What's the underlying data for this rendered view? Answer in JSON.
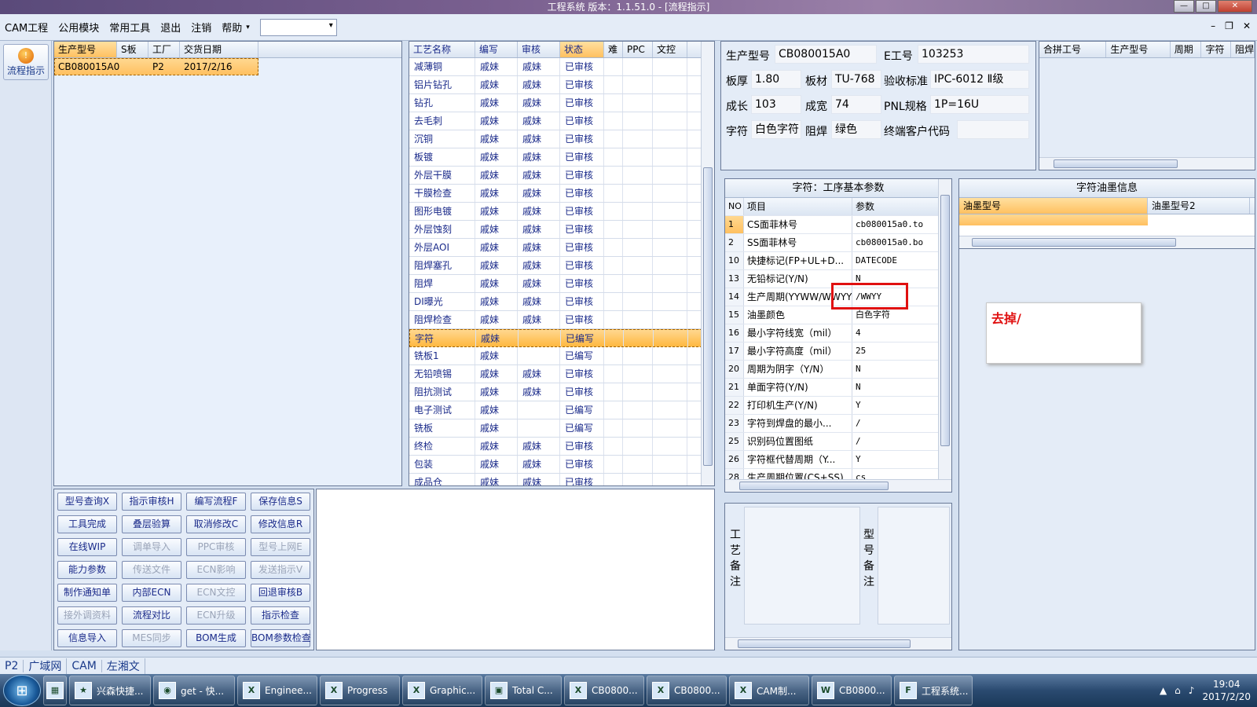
{
  "title": "工程系统  版本：1.1.51.0 - [流程指示]",
  "menu": [
    "CAM工程",
    "公用模块",
    "常用工具",
    "退出",
    "注销",
    "帮助"
  ],
  "flow_button": "流程指示",
  "orders": {
    "headers": [
      "生产型号",
      "S板",
      "工厂",
      "交货日期"
    ],
    "rows": [
      [
        "CB080015A0",
        "",
        "P2",
        "2017/2/16"
      ]
    ]
  },
  "process": {
    "headers": [
      "工艺名称",
      "编写",
      "审核",
      "状态",
      "难",
      "PPC",
      "文控"
    ],
    "rows": [
      [
        "减薄铜",
        "戚妹",
        "戚妹",
        "已审核"
      ],
      [
        "铝片钻孔",
        "戚妹",
        "戚妹",
        "已审核"
      ],
      [
        "钻孔",
        "戚妹",
        "戚妹",
        "已审核"
      ],
      [
        "去毛刺",
        "戚妹",
        "戚妹",
        "已审核"
      ],
      [
        "沉铜",
        "戚妹",
        "戚妹",
        "已审核"
      ],
      [
        "板镀",
        "戚妹",
        "戚妹",
        "已审核"
      ],
      [
        "外层干膜",
        "戚妹",
        "戚妹",
        "已审核"
      ],
      [
        "干膜检查",
        "戚妹",
        "戚妹",
        "已审核"
      ],
      [
        "图形电镀",
        "戚妹",
        "戚妹",
        "已审核"
      ],
      [
        "外层蚀刻",
        "戚妹",
        "戚妹",
        "已审核"
      ],
      [
        "外层AOI",
        "戚妹",
        "戚妹",
        "已审核"
      ],
      [
        "阻焊塞孔",
        "戚妹",
        "戚妹",
        "已审核"
      ],
      [
        "阻焊",
        "戚妹",
        "戚妹",
        "已审核"
      ],
      [
        "DI曝光",
        "戚妹",
        "戚妹",
        "已审核"
      ],
      [
        "阻焊检查",
        "戚妹",
        "戚妹",
        "已审核"
      ],
      [
        "字符",
        "戚妹",
        "",
        "已编写"
      ],
      [
        "铣板1",
        "戚妹",
        "",
        "已编写"
      ],
      [
        "无铅喷锡",
        "戚妹",
        "戚妹",
        "已审核"
      ],
      [
        "阻抗测试",
        "戚妹",
        "戚妹",
        "已审核"
      ],
      [
        "电子测试",
        "戚妹",
        "",
        "已编写"
      ],
      [
        "铣板",
        "戚妹",
        "",
        "已编写"
      ],
      [
        "终检",
        "戚妹",
        "戚妹",
        "已审核"
      ],
      [
        "包装",
        "戚妹",
        "戚妹",
        "已审核"
      ],
      [
        "成品仓",
        "戚妹",
        "戚妹",
        "已审核"
      ]
    ]
  },
  "buttons": [
    [
      "型号查询X",
      "指示审核H",
      "编写流程F",
      "保存信息S"
    ],
    [
      "工具完成",
      "叠层验算",
      "取消修改C",
      "修改信息R"
    ],
    [
      "在线WIP",
      "调单导入",
      "PPC审核",
      "型号上网E"
    ],
    [
      "能力参数",
      "传送文件",
      "ECN影响",
      "发送指示V"
    ],
    [
      "制作通知单",
      "内部ECN",
      "ECN文控",
      "回退审核B"
    ],
    [
      "接外调资料",
      "流程对比",
      "ECN升级",
      "指示检查"
    ],
    [
      "信息导入",
      "MES同步",
      "BOM生成",
      "BOM参数检查"
    ]
  ],
  "disabled_buttons": [
    "调单导入",
    "PPC审核",
    "型号上网E",
    "传送文件",
    "ECN影响",
    "发送指示V",
    "ECN文控",
    "接外调资料",
    "ECN升级",
    "MES同步"
  ],
  "info": {
    "l_model": "生产型号",
    "model": "CB080015A0",
    "l_e": "E工号",
    "e": "103253",
    "l_thick": "板厚",
    "thick": "1.80",
    "l_mat": "板材",
    "mat": "TU-768",
    "l_acc": "验收标准",
    "acc": "IPC-6012 Ⅱ级",
    "l_len": "成长",
    "len": "103",
    "l_wid": "成宽",
    "wid": "74",
    "l_pnl": "PNL规格",
    "pnl": "1P=16U",
    "l_char": "字符",
    "char": "白色字符",
    "l_mask": "阻焊",
    "mask": "绿色",
    "l_cust": "终端客户代码",
    "cust": ""
  },
  "merge_headers": [
    "合拼工号",
    "生产型号",
    "周期",
    "字符",
    "阻焊"
  ],
  "params": {
    "title": "字符：工序基本参数",
    "headers": [
      "NO",
      "项目",
      "参数"
    ],
    "rows": [
      [
        "1",
        "CS面菲林号",
        "cb080015a0.to"
      ],
      [
        "2",
        "SS面菲林号",
        "cb080015a0.bo"
      ],
      [
        "10",
        "快捷标记(FP+UL+D...",
        "DATECODE"
      ],
      [
        "13",
        "无铅标记(Y/N)",
        "N"
      ],
      [
        "14",
        "生产周期(YYWW/WWYY)",
        "/WWYY"
      ],
      [
        "15",
        "油墨颜色",
        "白色字符"
      ],
      [
        "16",
        "最小字符线宽（mil）",
        "4"
      ],
      [
        "17",
        "最小字符高度（mil）",
        "25"
      ],
      [
        "20",
        "周期为阴字（Y/N）",
        "N"
      ],
      [
        "21",
        "单面字符(Y/N)",
        "N"
      ],
      [
        "22",
        "打印机生产(Y/N)",
        "Y"
      ],
      [
        "23",
        "字符到焊盘的最小...",
        "/"
      ],
      [
        "25",
        "识别码位置图纸",
        "/"
      ],
      [
        "26",
        "字符框代替周期（Y...",
        "Y"
      ],
      [
        "28",
        "生产周期位置(CS+SS)",
        "cs"
      ]
    ]
  },
  "notes": {
    "process_label": "工艺备注",
    "model_label": "型号备注"
  },
  "ink": {
    "title": "字符油墨信息",
    "headers": [
      "油墨型号",
      "油墨型号2"
    ]
  },
  "popup": "去掉/",
  "status": [
    "P2",
    "广域网",
    "CAM",
    "左湘文"
  ],
  "taskbar": [
    "兴森快捷...",
    "get - 快...",
    "Enginee...",
    "Progress",
    "Graphic...",
    "Total C...",
    "CB0800...",
    "CB0800...",
    "CAM制...",
    "CB0800...",
    "工程系统..."
  ],
  "clock": {
    "time": "19:04",
    "date": "2017/2/20"
  }
}
